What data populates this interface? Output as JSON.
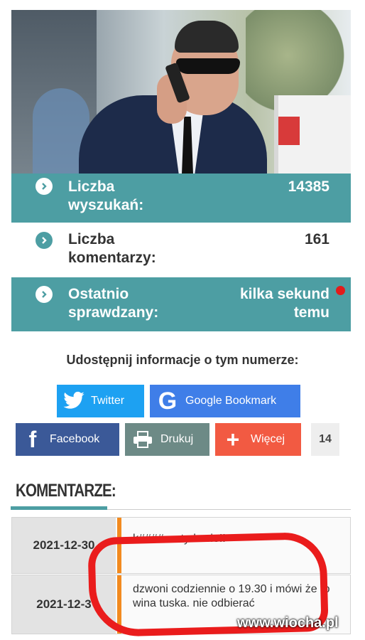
{
  "stats": [
    {
      "label": "Liczba wyszukań:",
      "value": "14385"
    },
    {
      "label": "Liczba komentarzy:",
      "value": "161"
    },
    {
      "label": "Ostatnio sprawdzany:",
      "value": "kilka sekund temu"
    }
  ],
  "share": {
    "title": "Udostępnij informacje o tym numerze:",
    "twitter": "Twitter",
    "google": "Google Bookmark",
    "facebook": "Facebook",
    "print": "Drukuj",
    "more": "Więcej",
    "count": "14"
  },
  "comments": {
    "heading": "KOMENTARZE:",
    "items": [
      {
        "date": "2021-12-30",
        "text": "k#### wstydz sie!!"
      },
      {
        "date": "2021-12-3",
        "text": "dzwoni codziennie o 19.30 i mówi że to wina tuska. nie odbierać"
      }
    ]
  },
  "watermark": "www.wiocha.pl",
  "colors": {
    "teal": "#4d9ea3",
    "twitter": "#1da1f2",
    "google": "#3f7ee8",
    "facebook": "#3b5998",
    "print": "#6d8a86",
    "more": "#f25a42",
    "accent": "#f28a1f",
    "highlight": "#ea1c1c"
  }
}
